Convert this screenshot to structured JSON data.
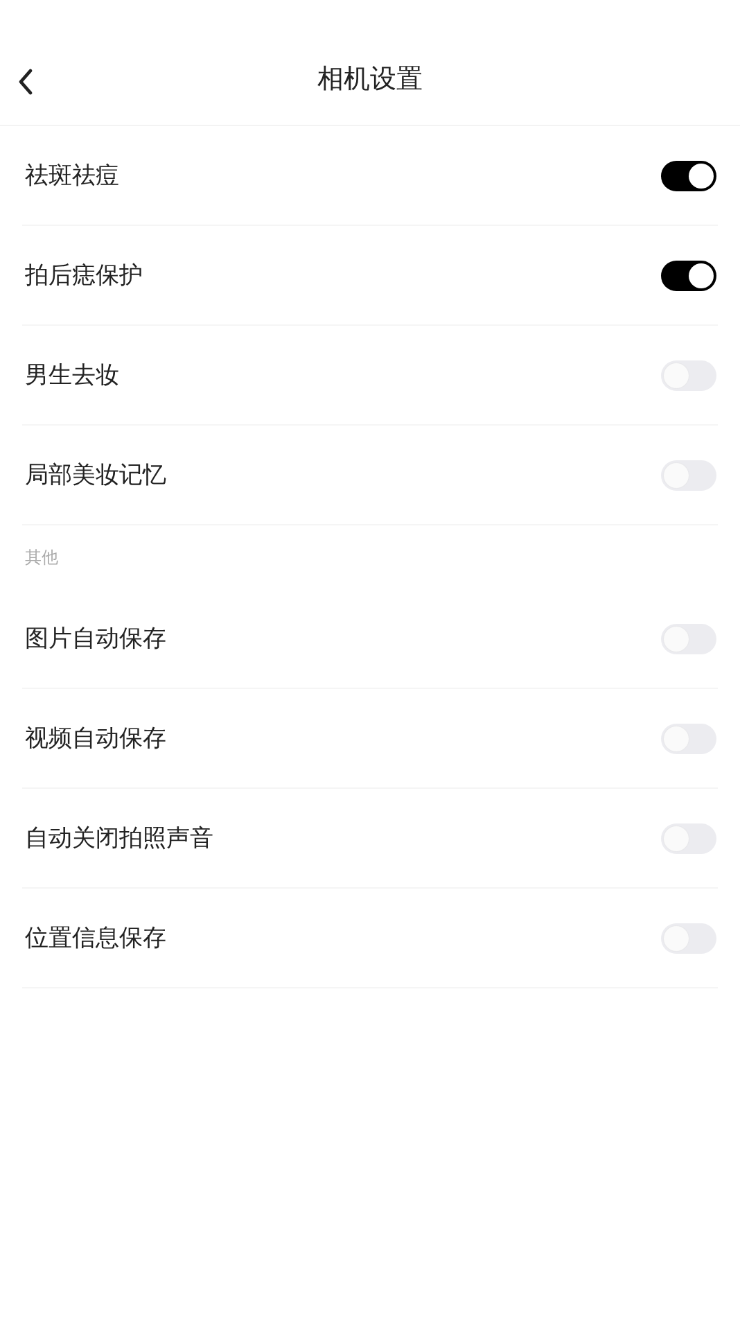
{
  "header": {
    "title": "相机设置"
  },
  "sections": [
    {
      "items": [
        {
          "label": "祛斑祛痘",
          "on": true
        },
        {
          "label": "拍后痣保护",
          "on": true
        },
        {
          "label": "男生去妆",
          "on": false
        },
        {
          "label": "局部美妆记忆",
          "on": false
        }
      ]
    },
    {
      "heading": "其他",
      "items": [
        {
          "label": "图片自动保存",
          "on": false
        },
        {
          "label": "视频自动保存",
          "on": false
        },
        {
          "label": "自动关闭拍照声音",
          "on": false
        },
        {
          "label": "位置信息保存",
          "on": false
        }
      ]
    }
  ]
}
